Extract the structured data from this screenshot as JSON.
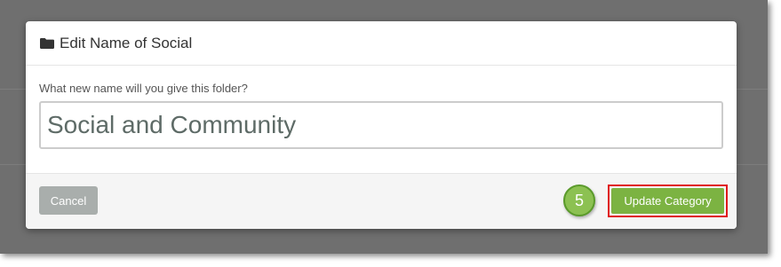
{
  "dialog": {
    "title": "Edit Name of Social",
    "folder_icon": "folder-icon"
  },
  "form": {
    "label": "What new name will you give this folder?",
    "value": "Social and Community"
  },
  "footer": {
    "cancel_label": "Cancel",
    "update_label": "Update Category",
    "step_number": "5"
  },
  "colors": {
    "primary_button": "#7cb342",
    "cancel_button": "#a9aeac",
    "highlight_border": "#e0191b",
    "step_badge": "#8cc152"
  }
}
